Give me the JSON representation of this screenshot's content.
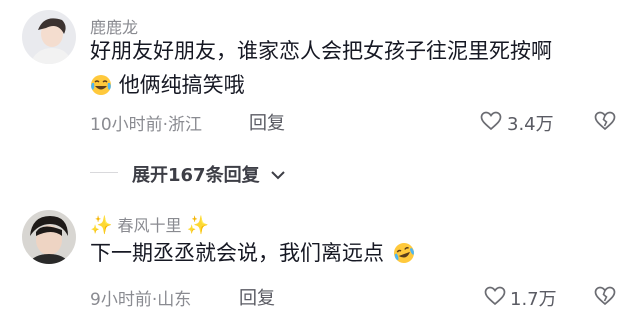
{
  "comments": [
    {
      "username": "鹿鹿龙",
      "line1": "好朋友好朋友，谁家恋人会把女孩子往泥里死按啊",
      "line2_emoji": "tears-of-joy-emoji",
      "line2": "他俩纯搞笑哦",
      "meta": "10小时前·浙江",
      "reply_label": "回复",
      "like_icon": "heart-outline-icon",
      "like_count": "3.4万",
      "dislike_icon": "broken-heart-icon"
    },
    {
      "username": "春风十里",
      "username_decoration": "sparkle-icon",
      "line1": "下一期丞丞就会说，我们离远点",
      "line1_emoji": "tears-of-joy-emoji",
      "meta": "9小时前·山东",
      "reply_label": "回复",
      "like_icon": "heart-outline-icon",
      "like_count": "1.7万",
      "dislike_icon": "broken-heart-icon"
    }
  ],
  "expand_replies": {
    "label": "展开167条回复",
    "icon": "chevron-down-icon"
  },
  "colors": {
    "text_primary": "#161823",
    "text_secondary": "#8a8b91",
    "divider": "#d9d9dc",
    "sparkle": "#f3c33a"
  }
}
